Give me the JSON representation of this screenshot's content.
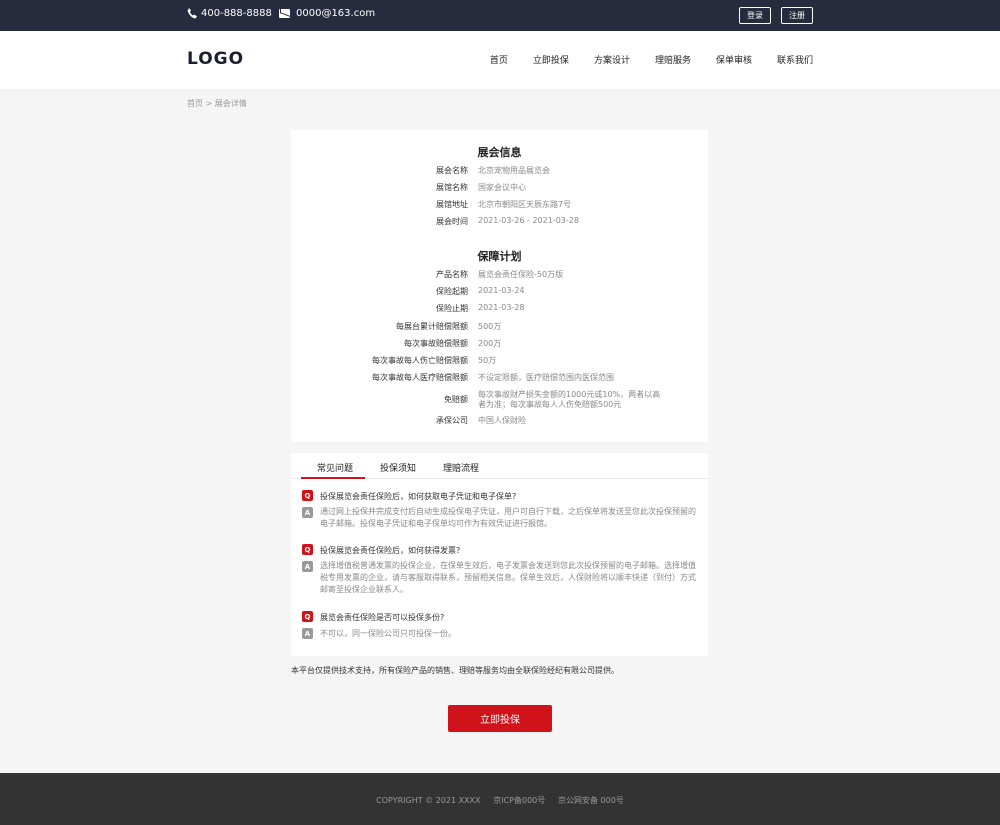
{
  "topbar": {
    "phone": "400-888-8888",
    "email": "0000@163.com",
    "login_label": "登录",
    "register_label": "注册"
  },
  "header": {
    "logo": "LOGO",
    "nav": [
      "首页",
      "立即投保",
      "方案设计",
      "理赔服务",
      "保单审核",
      "联系我们"
    ]
  },
  "breadcrumb": "首页 > 展会详情",
  "exhibition": {
    "title": "展会信息",
    "rows": [
      {
        "label": "展会名称",
        "value": "北京宠物用品展览会"
      },
      {
        "label": "展馆名称",
        "value": "国家会议中心"
      },
      {
        "label": "展馆地址",
        "value": "北京市朝阳区天辰东路7号"
      },
      {
        "label": "展会时间",
        "value": "2021-03-26 - 2021-03-28"
      }
    ]
  },
  "plan": {
    "title": "保障计划",
    "rows": [
      {
        "label": "产品名称",
        "value": "展览会责任保险-50万版"
      },
      {
        "label": "保险起期",
        "value": "2021-03-24"
      },
      {
        "label": "保险止期",
        "value": "2021-03-28"
      },
      {
        "label": "每展台累计赔偿限额",
        "value": "500万"
      },
      {
        "label": "每次事故赔偿限额",
        "value": "200万"
      },
      {
        "label": "每次事故每人伤亡赔偿限额",
        "value": "50万"
      },
      {
        "label": "每次事故每人医疗赔偿限额",
        "value": "不设定限额，医疗赔偿范围内医保范围"
      },
      {
        "label": "免赔额",
        "value": "每次事故财产损失金额的1000元或10%，两者以高者为准；每次事故每人人伤免赔额500元"
      },
      {
        "label": "承保公司",
        "value": "中国人保财险"
      }
    ]
  },
  "tabs": [
    "常见问题",
    "投保须知",
    "理赔流程"
  ],
  "faq": {
    "q_badge": "Q",
    "a_badge": "A",
    "items": [
      {
        "q": "投保展览会责任保险后，如何获取电子凭证和电子保单?",
        "a": "通过网上投保并完成支付后自动生成投保电子凭证，用户可自行下载，之后保单将发送至您此次投保预留的电子邮箱。投保电子凭证和电子保单均可作为有效凭证进行报馆。"
      },
      {
        "q": "投保展览会责任保险后，如何获得发票?",
        "a": "选择增值税普通发票的投保企业，在保单生效后，电子发票会发送到您此次投保预留的电子邮箱。选择增值税专用发票的企业，请与客服取得联系，预留相关信息。保单生效后，人保财险将以顺丰快递（到付）方式邮寄至投保企业联系人。"
      },
      {
        "q": "展览会责任保险是否可以投保多份?",
        "a": "不可以，同一保险公司只可投保一份。"
      }
    ]
  },
  "disclaimer": "本平台仅提供技术支持，所有保险产品的销售、理赔等服务均由全联保险经纪有限公司提供。",
  "cta_label": "立即投保",
  "footer": {
    "copyright": "COPYRIGHT © 2021 XXXX     京ICP备000号     京公网安备 000号"
  },
  "colors": {
    "topbar_bg": "#272b3e",
    "accent_red": "#d0121b",
    "footer_bg": "#333333"
  }
}
